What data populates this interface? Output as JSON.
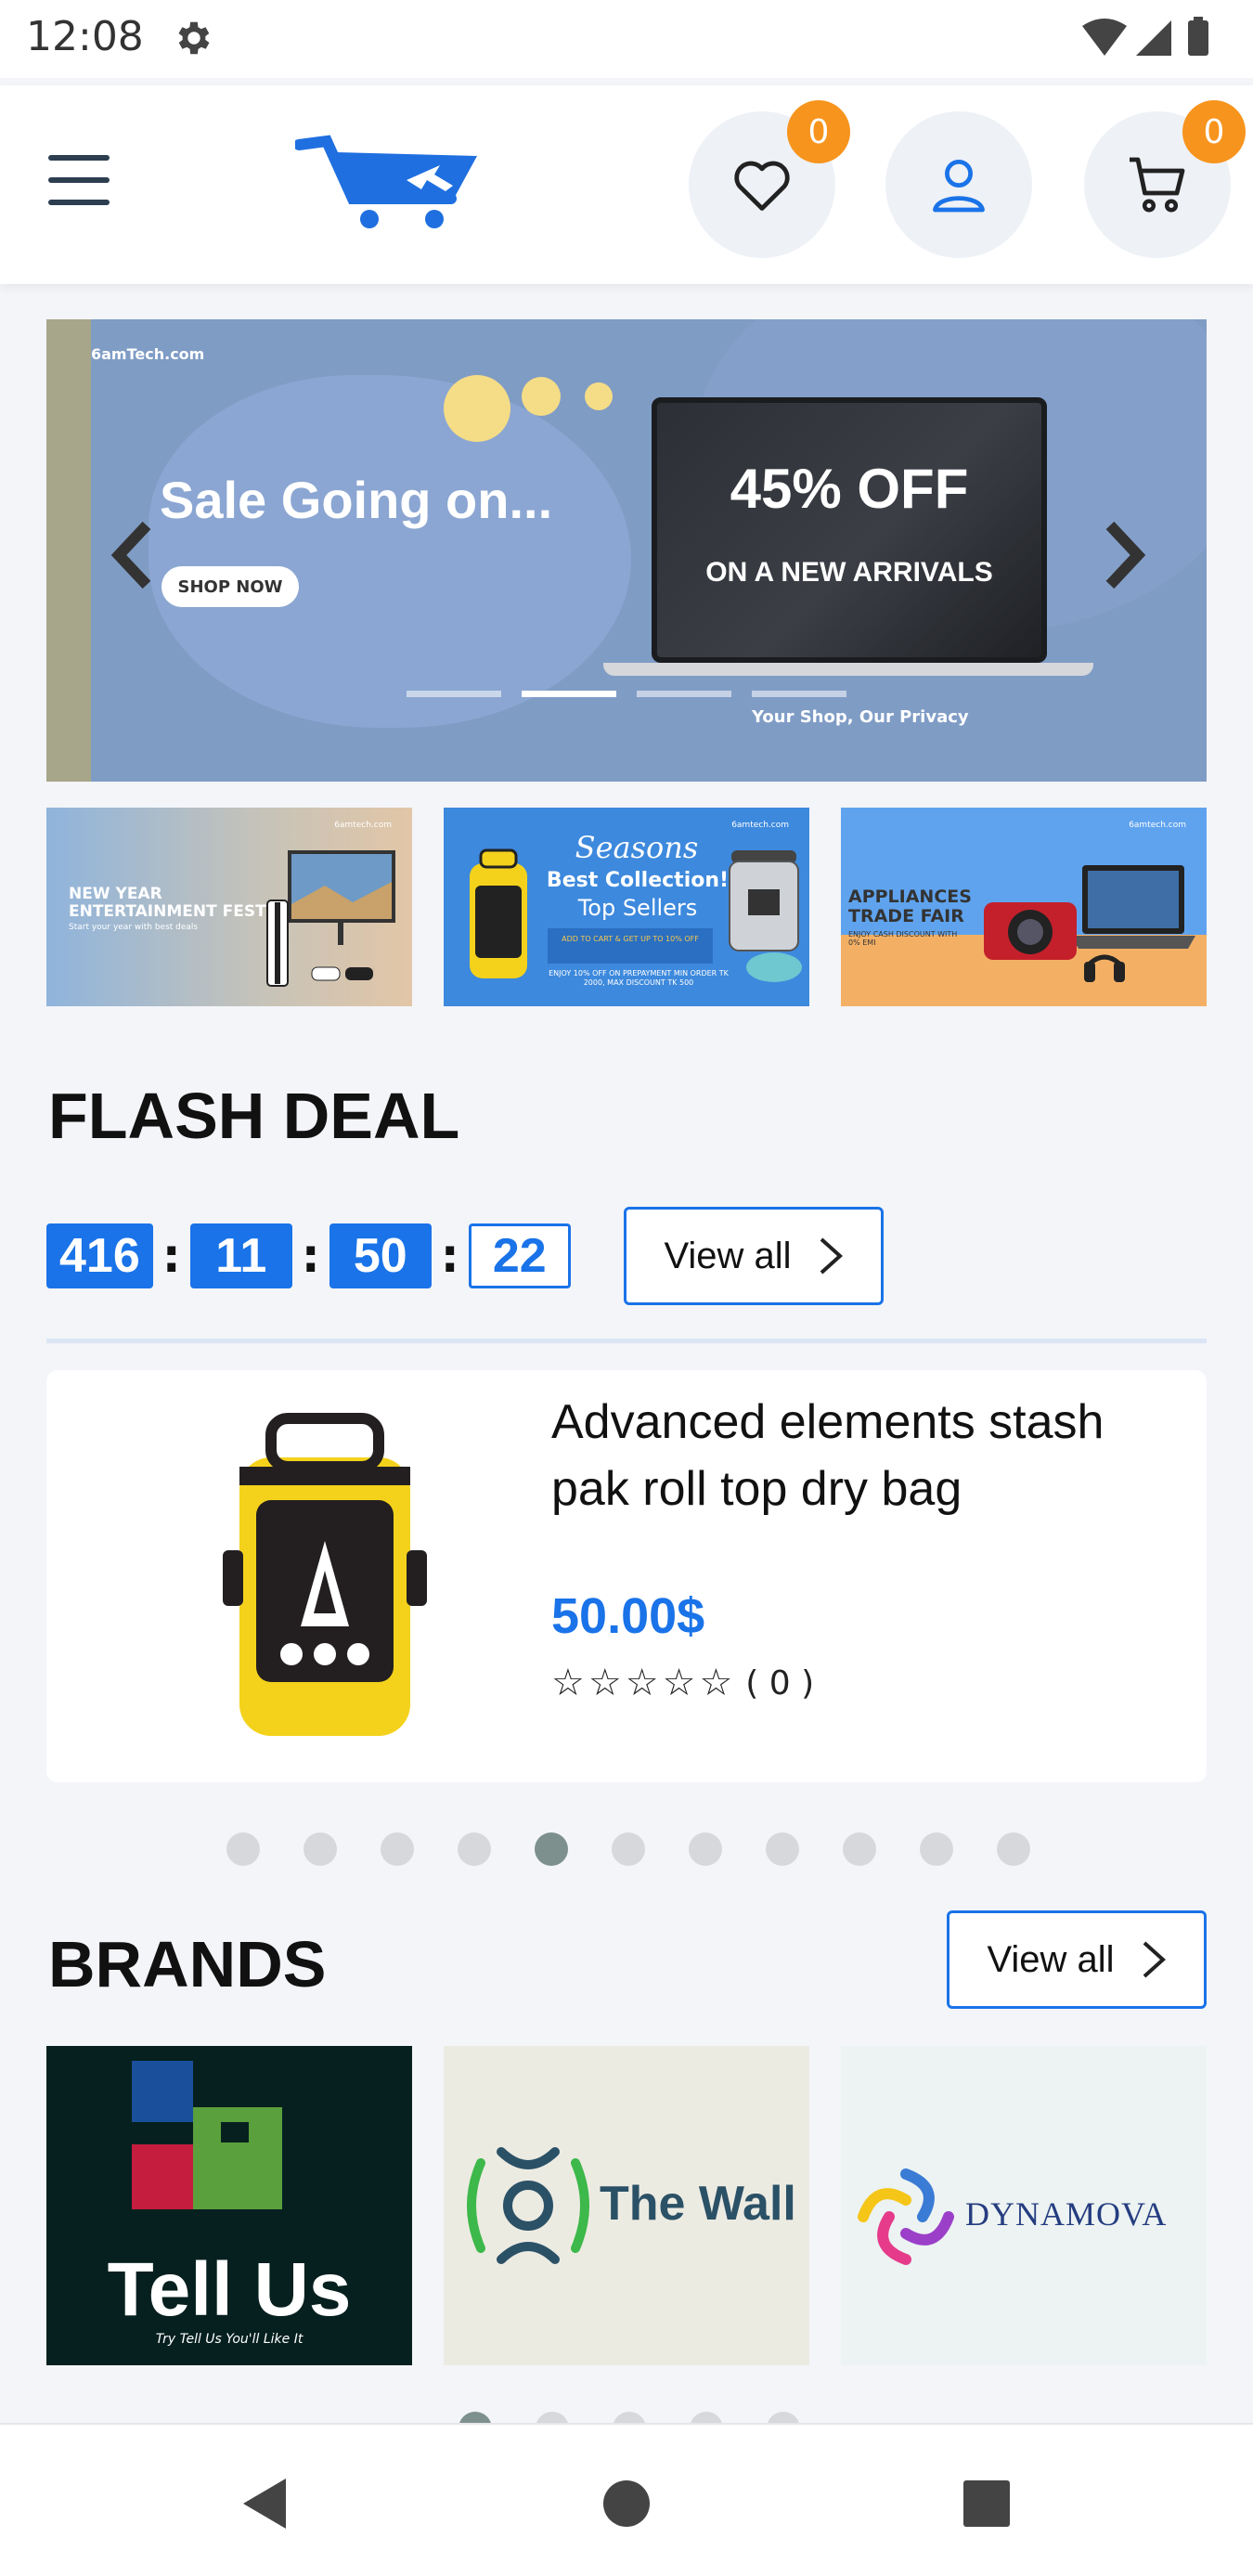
{
  "status_bar": {
    "time": "12:08"
  },
  "header": {
    "wishlist_count": "0",
    "cart_count": "0"
  },
  "hero": {
    "site": "6amTech.com",
    "headline": "Sale Going on...",
    "button": "SHOP NOW",
    "offer": "45% OFF",
    "offer_sub": "ON A NEW ARRIVALS",
    "tagline": "Your Shop, Our Privacy",
    "slides": 4,
    "active_slide": 1
  },
  "sub_banners": {
    "b1": {
      "site": "6amtech.com",
      "title": "NEW YEAR ENTERTAINMENT FEST",
      "desc": "Start your year with best deals"
    },
    "b2": {
      "site": "6amtech.com",
      "title": "Seasons",
      "best": "Best Collection!",
      "top": "Top Sellers",
      "cart": "ADD TO CART & GET UP TO 10% OFF",
      "fine": "ENJOY 10% OFF ON PREPAYMENT MIN ORDER TK 2000, MAX DISCOUNT TK 500"
    },
    "b3": {
      "site": "6amtech.com",
      "title": "APPLIANCES TRADE FAIR",
      "desc": "ENJOY CASH DISCOUNT WITH 0% EMI"
    }
  },
  "flash_deal": {
    "title": "FLASH DEAL",
    "timer": {
      "days": "416",
      "hours": "11",
      "minutes": "50",
      "seconds": "22"
    },
    "view_all": "View all",
    "product": {
      "name": "Advanced elements stash pak roll top dry bag",
      "price": "50.00$",
      "rating_stars": 0,
      "rating_count": "( 0 )"
    },
    "pager_total": 11,
    "pager_active": 4
  },
  "brands": {
    "title": "BRANDS",
    "view_all": "View all",
    "items": [
      {
        "name": "Tell Us",
        "tagline": "Try Tell Us You'll Like It"
      },
      {
        "name": "The Wall"
      },
      {
        "name": "DYNAMOVA"
      }
    ]
  },
  "colors": {
    "accent": "#1a73e8",
    "badge": "#f7941d",
    "page_bg": "#f3f5f9"
  }
}
